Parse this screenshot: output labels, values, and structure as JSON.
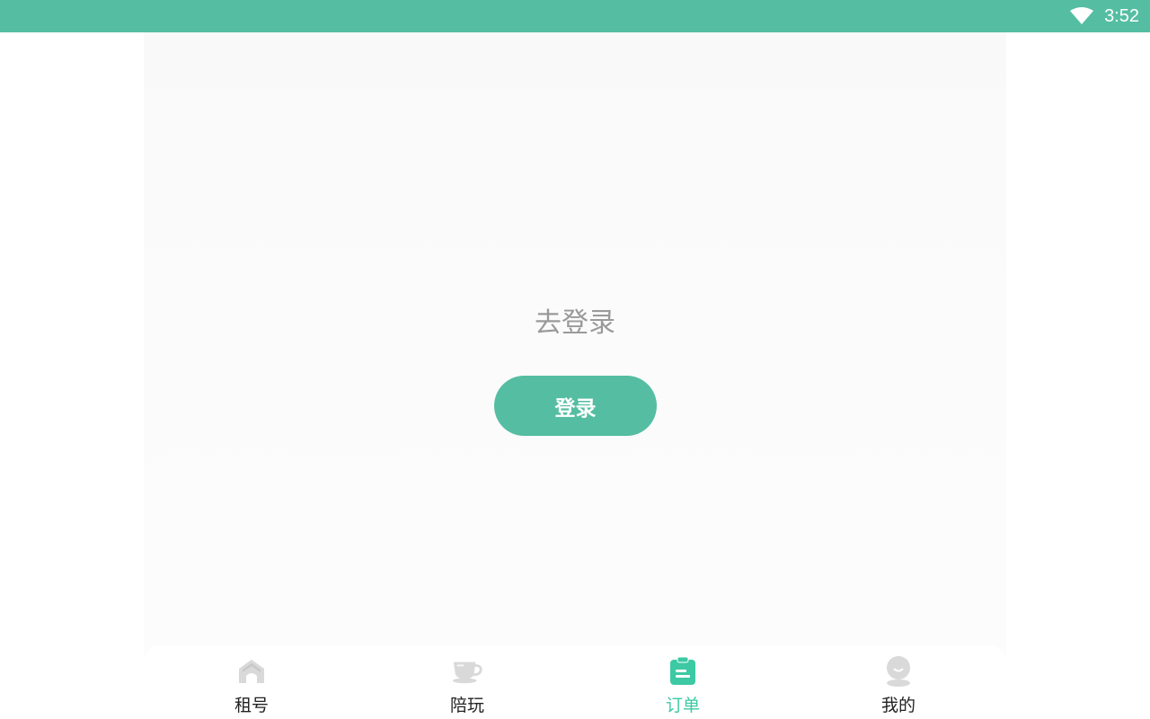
{
  "status_bar": {
    "time": "3:52",
    "icons": [
      "wifi-icon"
    ]
  },
  "main": {
    "prompt": "去登录",
    "login_button": "登录"
  },
  "tab_bar": {
    "active_index": 2,
    "active_color": "#3cc9a3",
    "tabs": [
      {
        "label": "租号",
        "icon": "home-icon"
      },
      {
        "label": "陪玩",
        "icon": "cup-icon"
      },
      {
        "label": "订单",
        "icon": "order-clipboard-icon"
      },
      {
        "label": "我的",
        "icon": "profile-icon"
      }
    ]
  },
  "colors": {
    "brand": "#55bea2",
    "inactive_icon": "#d9d9d9"
  }
}
